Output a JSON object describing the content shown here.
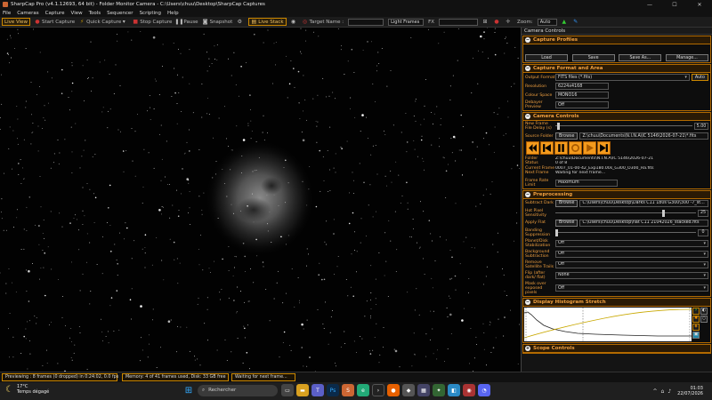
{
  "window": {
    "title": "SharpCap Pro (v4.1.12693, 64 bit) - Folder Monitor Camera - C:\\Users\\chuu\\Desktop\\SharpCap Captures",
    "min": "—",
    "max": "☐",
    "close": "✕"
  },
  "menu": [
    "File",
    "Cameras",
    "Capture",
    "View",
    "Tools",
    "Sequencer",
    "Scripting",
    "Help"
  ],
  "toolbar": {
    "live_view": "Live View",
    "start_capture": "Start Capture",
    "quick_capture": "Quick Capture",
    "stop_capture": "Stop Capture",
    "pause": "Pause",
    "snapshot": "Snapshot",
    "live_stack": "Live Stack",
    "target_name_label": "Target Name :",
    "target_name_value": "",
    "light_frames": "Light Frames",
    "fx_label": "FX",
    "fx_value": "",
    "zoom_label": "Zoom:",
    "zoom_value": "Auto"
  },
  "panel": {
    "title": "Camera Controls",
    "capture_profiles": {
      "title": "Capture Profiles",
      "load": "Load",
      "save": "Save",
      "save_as": "Save As...",
      "manage": "Manage..."
    },
    "capture_format": {
      "title": "Capture Format and Area",
      "output_format_label": "Output Format",
      "output_format_value": "FITS files (*.fits)",
      "auto": "Auto",
      "resolution_label": "Resolution",
      "resolution_value": "6224x4168",
      "colour_space_label": "Colour Space",
      "colour_space_value": "MONO16",
      "debayer_label": "Debayer Preview",
      "debayer_value": "Off"
    },
    "camera_controls": {
      "title": "Camera Controls",
      "new_frame_delay_label": "New Frame File Delay (s)",
      "new_frame_delay_value": "5.00",
      "source_folder_label": "Source Folder",
      "browse": "Browse",
      "source_folder_value": "Z:\\chuu\\Documents\\N.I.N.A\\IC 5146\\2026-07-21\\*.fits",
      "folder_label": "Folder",
      "folder_value": "Z:\\chuu\\Documents\\N.I.N.A\\IC 5146\\2026-07-21",
      "status_label": "Status",
      "status_value": "0 of 8",
      "current_frame_label": "Current Frame",
      "current_frame_value": "0007_01-00-42_Exp180.00s_G300_O300_Ha.fits",
      "next_frame_label": "Next Frame",
      "next_frame_value": "Waiting for next frame...",
      "frame_rate_label": "Frame Rate Limit",
      "frame_rate_value": "Maximum"
    },
    "preprocessing": {
      "title": "Preprocessing",
      "subtract_dark_label": "Subtract Dark",
      "browse": "Browse",
      "subtract_dark_value": "C:\\Users\\chuu\\Desktop\\Darks C11 180s G300\\300 -7_st...",
      "hot_pixel_label": "Hot Pixel Sensitivity",
      "hot_pixel_value": "25",
      "apply_flat_label": "Apply Flat",
      "apply_flat_value": "C:\\Users\\chuu\\Desktop\\flat C11 21042026_stacked.fits",
      "banding_label": "Banding Suppression",
      "banding_value": "0",
      "planet_disk_label": "Planet/Disk Stabilization",
      "planet_disk_value": "Off",
      "background_label": "Background Subtraction",
      "background_value": "Off",
      "satellite_label": "Remove Satellite Trails",
      "satellite_value": "Off",
      "flip_label": "Flip (after dark/ flat)",
      "flip_value": "None",
      "mask_label": "Mask over exposed pixels",
      "mask_value": "Off"
    },
    "histogram": {
      "title": "Display Histogram Stretch"
    },
    "scope": {
      "title": "Scope Controls"
    }
  },
  "status": {
    "preview": "Previewing : 8 frames (0 dropped) in 0:24:02, 0.0 fps",
    "memory": "Memory: 4 of 41 frames used, Disk: 33 GB free",
    "waiting": "Waiting for next frame..."
  },
  "taskbar": {
    "temp": "17°C",
    "weather": "Temps dégagé",
    "search": "Rechercher",
    "time": "01:03",
    "date": "22/07/2026"
  },
  "colors": {
    "accent": "#f39a1d",
    "border": "#b36a00",
    "label": "#f0a040"
  }
}
